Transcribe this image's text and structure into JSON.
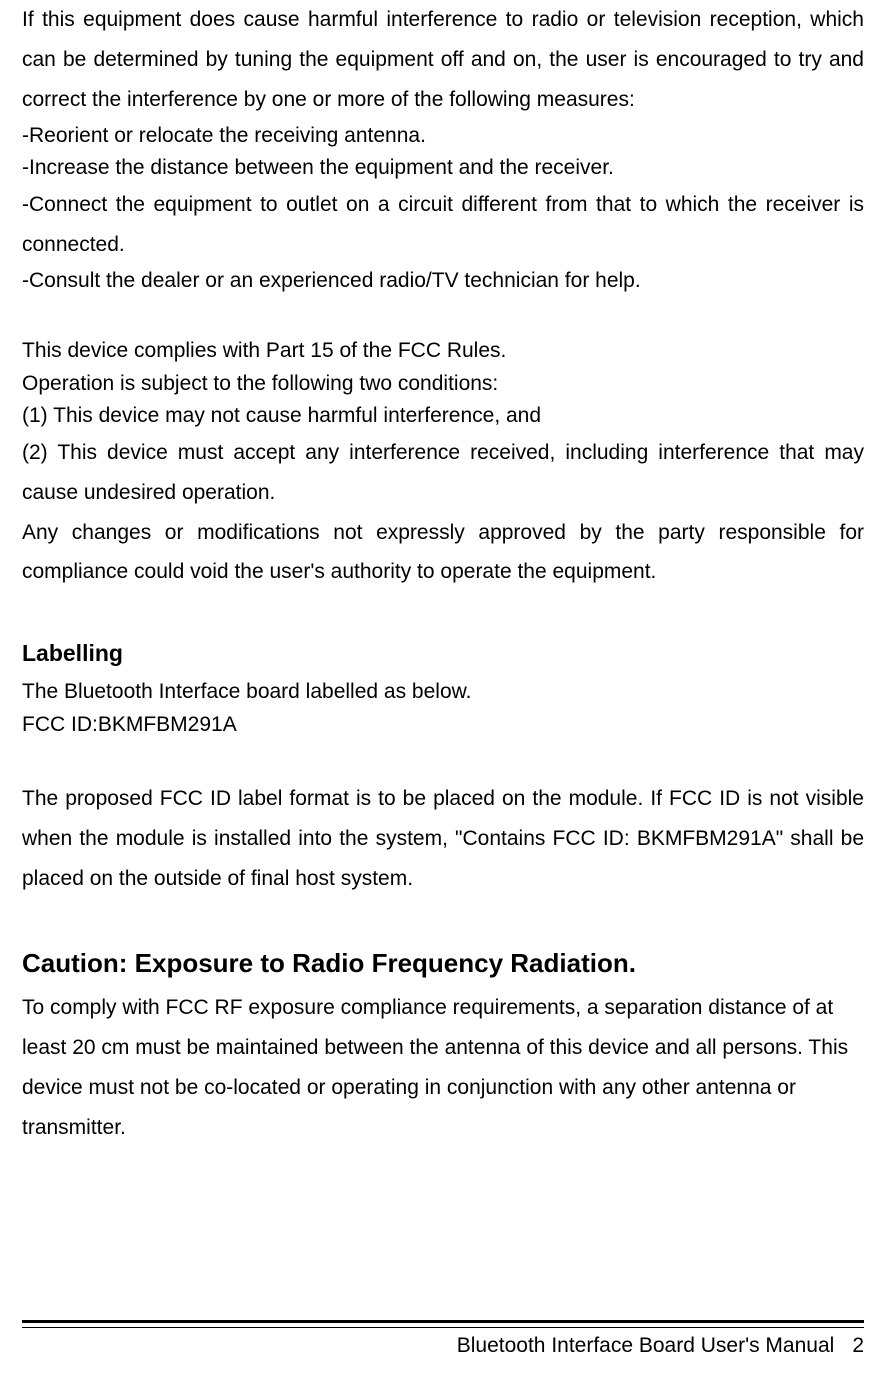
{
  "body": {
    "intro": "If this equipment does cause harmful interference to radio or television reception, which can be determined by tuning the equipment off and on, the user is encouraged to try and correct the interference by one or more of the following measures:",
    "bullet1": "-Reorient or relocate the receiving antenna.",
    "bullet2": "-Increase the distance between the equipment and the receiver.",
    "bullet3": "-Connect the equipment to outlet on a circuit different from that to which the receiver is connected.",
    "bullet4": "-Consult the dealer or an experienced radio/TV technician for help.",
    "complies": "This device complies with Part 15 of the FCC Rules.",
    "operation": "Operation is subject to the following two conditions:",
    "cond1": "(1) This device may not cause harmful interference, and",
    "cond2": "(2) This device must accept any interference received, including interference that may cause undesired operation.",
    "changes": "Any changes or modifications not expressly approved by the party responsible for compliance could void the user's authority to operate the equipment."
  },
  "labelling": {
    "heading": "Labelling",
    "line1": "The Bluetooth Interface board labelled as below.",
    "fccid": "FCC ID:BKMFBM291A",
    "para": "The proposed FCC ID label format is to be placed on the module. If FCC ID is not visible when the module is installed into the system, \"Contains FCC ID: BKMFBM291A\" shall be placed on the outside of final host system."
  },
  "caution": {
    "heading": "Caution: Exposure to Radio Frequency Radiation.",
    "para": "To comply with FCC RF exposure compliance requirements, a separation distance of at least 20 cm must be maintained between the antenna of this device and all persons. This device must not be co-located or operating in conjunction with any other antenna or transmitter."
  },
  "footer": {
    "title": "Bluetooth Interface Board User's Manual",
    "page": "2"
  }
}
